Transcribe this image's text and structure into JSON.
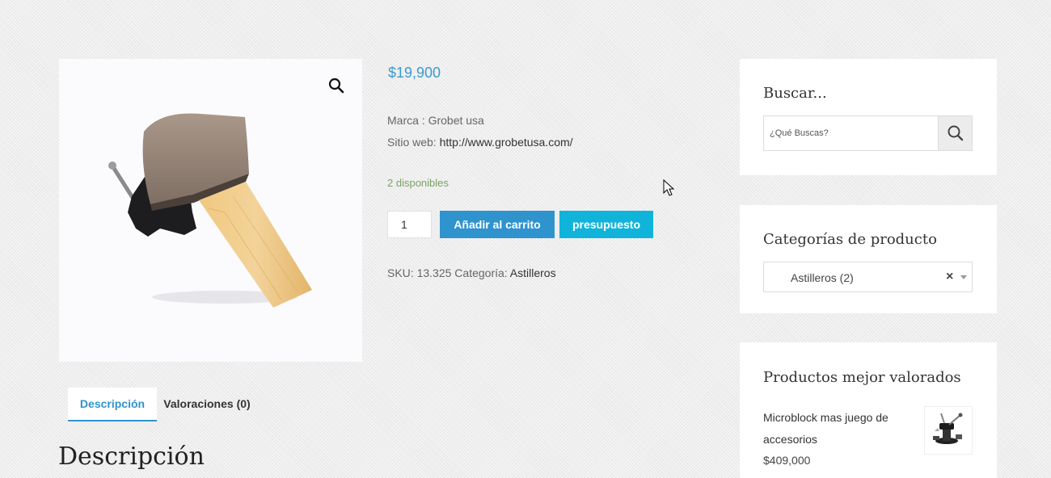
{
  "product": {
    "price": "$19,900",
    "brand_label": "Marca : ",
    "brand_value": "Grobet usa",
    "website_label": "Sitio web: ",
    "website_url": "http://www.grobetusa.com/",
    "stock": "2 disponibles",
    "quantity": "1",
    "add_to_cart_label": "Añadir al carrito",
    "quote_label": "presupuesto",
    "sku_label": "SKU: ",
    "sku_value": "13.325",
    "category_label": " Categoría: ",
    "category_value": "Astilleros",
    "zoom_icon": "magnifier-icon"
  },
  "tabs": [
    {
      "label": "Descripción",
      "active": true
    },
    {
      "label": "Valoraciones (0)",
      "active": false
    }
  ],
  "description_heading": "Descripción",
  "sidebar": {
    "search": {
      "title": "Buscar...",
      "placeholder": "¿Qué Buscas?",
      "button_icon": "search-icon"
    },
    "categories": {
      "title": "Categorías de producto",
      "selected": "Astilleros  (2)",
      "clear_symbol": "×"
    },
    "top_rated": {
      "title": "Productos mejor valorados",
      "items": [
        {
          "name": "Microblock mas juego de accesorios",
          "price": "$409,000"
        }
      ]
    }
  },
  "colors": {
    "accent_blue": "#2f93ce",
    "quote_cyan": "#10b4da",
    "price_blue": "#3a9bd0",
    "stock_green": "#77a464"
  }
}
